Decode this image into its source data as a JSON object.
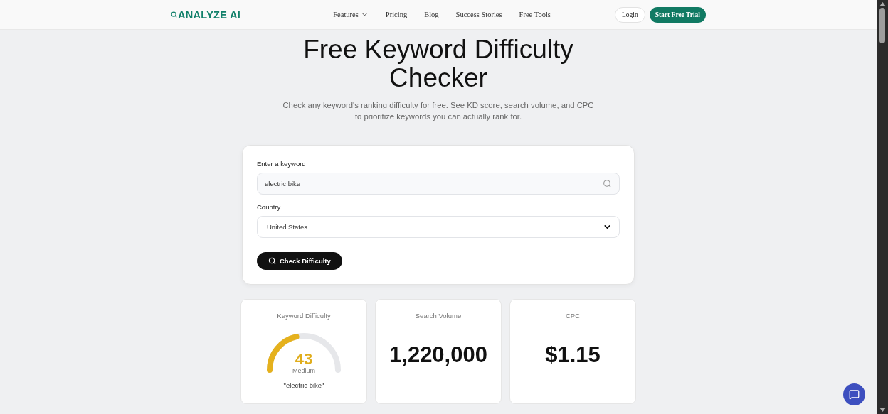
{
  "nav": {
    "logo": "ANALYZE AI",
    "links": [
      {
        "label": "Features",
        "dropdown": true
      },
      {
        "label": "Pricing",
        "dropdown": false
      },
      {
        "label": "Blog",
        "dropdown": false
      },
      {
        "label": "Success Stories",
        "dropdown": false
      },
      {
        "label": "Free Tools",
        "dropdown": false
      }
    ],
    "login": "Login",
    "cta": "Start Free Trial"
  },
  "hero": {
    "title": "Free Keyword Difficulty Checker",
    "subtitle": "Check any keyword's ranking difficulty for free. See KD score, search volume, and CPC to prioritize keywords you can actually rank for."
  },
  "form": {
    "keyword_label": "Enter a keyword",
    "keyword_value": "electric bike",
    "country_label": "Country",
    "country_value": "United States",
    "submit": "Check Difficulty"
  },
  "results": [
    {
      "kind": "gauge",
      "title": "Keyword Difficulty",
      "value": "43",
      "rating": "Medium",
      "keyword": "\"electric bike\""
    },
    {
      "kind": "number",
      "title": "Search Volume",
      "value": "1,220,000"
    },
    {
      "kind": "number",
      "title": "CPC",
      "value": "$1.15"
    }
  ]
}
